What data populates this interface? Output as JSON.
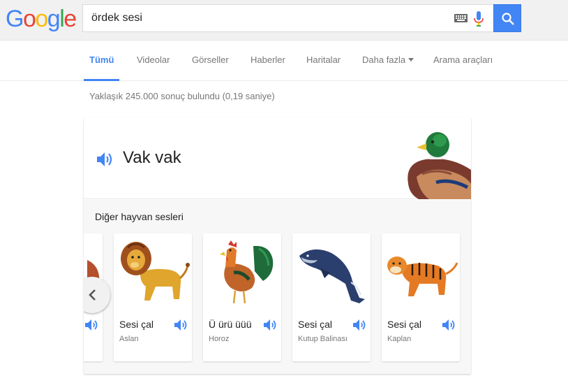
{
  "logo": {
    "text": "Google",
    "letters": [
      {
        "ch": "G",
        "color": "#4285f4"
      },
      {
        "ch": "o",
        "color": "#ea4335"
      },
      {
        "ch": "o",
        "color": "#fbbc05"
      },
      {
        "ch": "g",
        "color": "#4285f4"
      },
      {
        "ch": "l",
        "color": "#34a853"
      },
      {
        "ch": "e",
        "color": "#ea4335"
      }
    ]
  },
  "search": {
    "value": "ördek sesi",
    "keyboard_icon": "keyboard-icon",
    "mic_icon": "mic-icon",
    "button_icon": "search-icon"
  },
  "tabs": [
    {
      "label": "Tümü",
      "active": true
    },
    {
      "label": "Videolar"
    },
    {
      "label": "Görseller"
    },
    {
      "label": "Haberler"
    },
    {
      "label": "Haritalar"
    },
    {
      "label": "Daha fazla"
    },
    {
      "label": "Arama araçları"
    }
  ],
  "result_stats": "Yaklaşık 245.000 sonuç bulundu (0,19 saniye)",
  "card": {
    "sound_text": "Vak vak",
    "speaker_icon": "speaker-icon",
    "illustration": "duck-icon",
    "other_title": "Diğer hayvan sesleri",
    "animals": [
      {
        "play_label": "Sesi çal",
        "name": "Aslan",
        "icon": "lion-icon"
      },
      {
        "play_label": "Ü ürü üüü",
        "name": "Horoz",
        "icon": "rooster-icon"
      },
      {
        "play_label": "Sesi çal",
        "name": "Kutup Balinası",
        "icon": "whale-icon"
      },
      {
        "play_label": "Sesi çal",
        "name": "Kaplan",
        "icon": "tiger-icon"
      }
    ],
    "prev_icon": "chevron-left-icon"
  },
  "colors": {
    "accent": "#4285f4",
    "header_bg": "#f1f1f1",
    "card_bottom_bg": "#f7f7f7"
  }
}
